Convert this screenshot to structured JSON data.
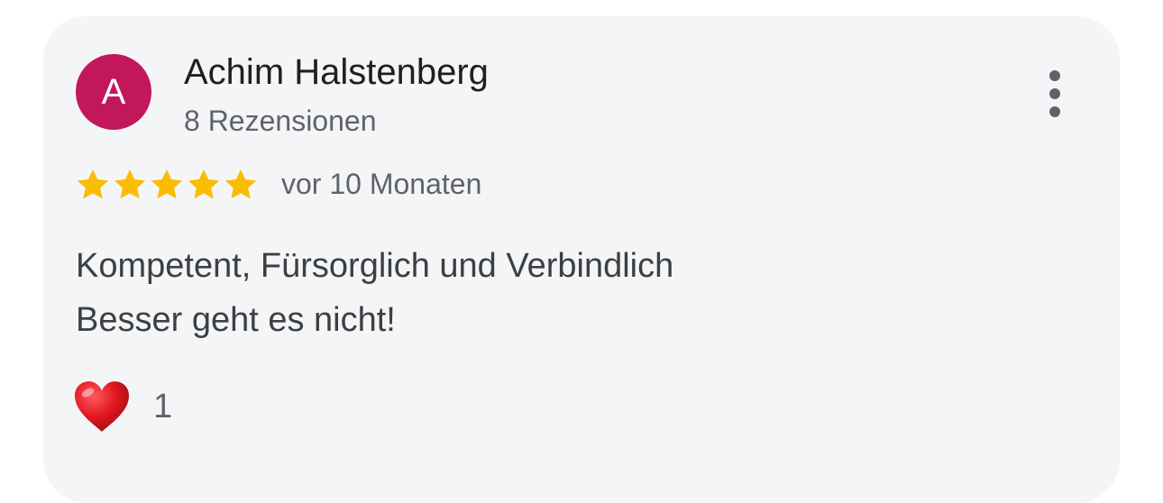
{
  "review": {
    "avatar_letter": "A",
    "avatar_color": "#c2185b",
    "reviewer_name": "Achim Halstenberg",
    "review_count": "8 Rezensionen",
    "rating": 5,
    "rating_max": 5,
    "star_color": "#fbbc04",
    "date": "vor 10 Monaten",
    "text_lines": [
      "Kompetent, Fürsorglich und Verbindlich",
      "Besser geht es nicht!"
    ],
    "reaction": {
      "icon": "heart-icon",
      "count": "1"
    },
    "menu_icon": "more-vert-icon"
  }
}
